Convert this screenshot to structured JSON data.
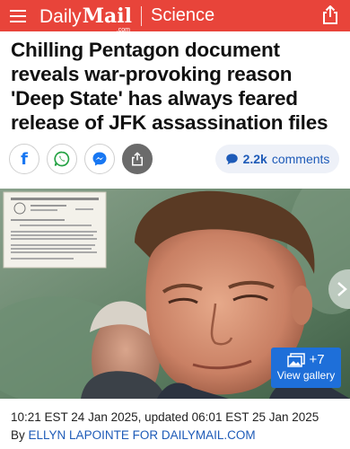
{
  "header": {
    "brand_daily": "Daily",
    "brand_mail": "Mail",
    "brand_com": ".com",
    "section": "Science",
    "bg_color": "#e8443a"
  },
  "article": {
    "headline": "Chilling Pentagon document reveals war-provoking reason 'Deep State' has always feared release of JFK assassination files",
    "comments_count": "2.2k",
    "comments_label": "comments",
    "gallery_count": "+7",
    "gallery_label": "View gallery",
    "timestamp": "10:21 EST 24 Jan 2025, updated 06:01 EST 25 Jan 2025",
    "byline_prefix": "By",
    "author": "ELLYN LAPOINTE FOR DAILYMAIL.COM"
  },
  "icons": {
    "menu": "hamburger-menu-icon",
    "share_top": "share-icon",
    "facebook": "facebook-icon",
    "whatsapp": "whatsapp-icon",
    "messenger": "messenger-icon",
    "share": "share-icon",
    "comment": "comment-bubble-icon",
    "gallery": "gallery-icon",
    "next": "chevron-right-icon"
  },
  "colors": {
    "accent": "#1e6fd9",
    "link": "#1e5bb8",
    "facebook": "#1877f2",
    "whatsapp": "#25a244",
    "messenger": "#1877f2"
  }
}
